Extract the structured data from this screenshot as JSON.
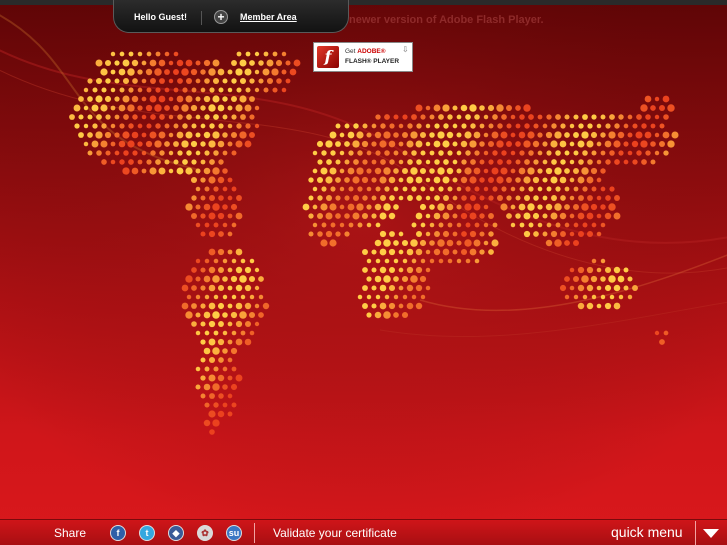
{
  "header": {
    "greeting": "Hello Guest!",
    "member_area": "Member Area",
    "plus_icon": "plus-circle-icon"
  },
  "flash": {
    "message": "newer version of Adobe Flash Player.",
    "badge_get": "Get",
    "badge_adobe": "ADOBE®",
    "badge_player": "FLASH® PLAYER",
    "logo_glyph": "f"
  },
  "footer": {
    "share_label": "Share",
    "social_icons": [
      {
        "name": "facebook-icon",
        "glyph": "f",
        "color": "#2f5fa8"
      },
      {
        "name": "twitter-icon",
        "glyph": "t",
        "color": "#35a8e0"
      },
      {
        "name": "delicious-icon",
        "glyph": "◆",
        "color": "#3a5a98"
      },
      {
        "name": "digg-icon",
        "glyph": "✿",
        "color": "#d9d9d9"
      },
      {
        "name": "stumbleupon-icon",
        "glyph": "su",
        "color": "#3a77c4"
      }
    ],
    "validate_label": "Validate your certificate",
    "quick_menu_label": "quick menu",
    "quick_menu_icon": "triangle-down-icon"
  },
  "colors": {
    "accent": "#d0161a",
    "dot_light": "#ffc13a",
    "dot_dark": "#ef4a1c"
  }
}
